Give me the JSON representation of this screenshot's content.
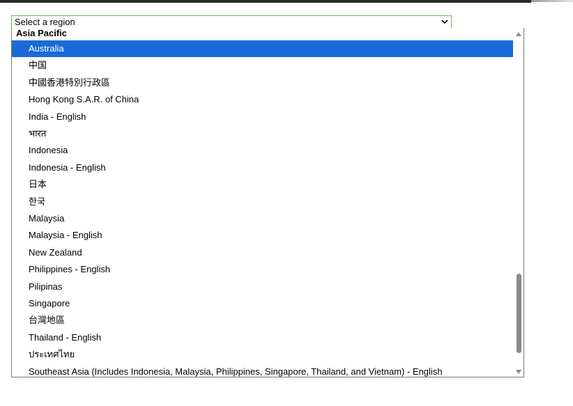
{
  "region_select": {
    "value": "Select a region",
    "group_label": "Asia Pacific",
    "options": [
      "Australia",
      "中国",
      "中國香港特別行政區",
      "Hong Kong S.A.R. of China",
      "India - English",
      "भारत",
      "Indonesia",
      "Indonesia - English",
      "日本",
      "한국",
      "Malaysia",
      "Malaysia - English",
      "New Zealand",
      "Philippines - English",
      "Pilipinas",
      "Singapore",
      "台灣地區",
      "Thailand - English",
      "ประเทศไทย",
      "Southeast Asia (Includes Indonesia, Malaysia, Philippines, Singapore, Thailand, and Vietnam) - English"
    ],
    "highlighted_option": "Australia",
    "colors": {
      "focus_border": "#5cbf3a",
      "highlight": "#1a6ad8"
    },
    "icons": {
      "dropdown": "chevron-down-icon",
      "scroll_up": "triangle-up-icon",
      "scroll_down": "triangle-down-icon"
    }
  }
}
